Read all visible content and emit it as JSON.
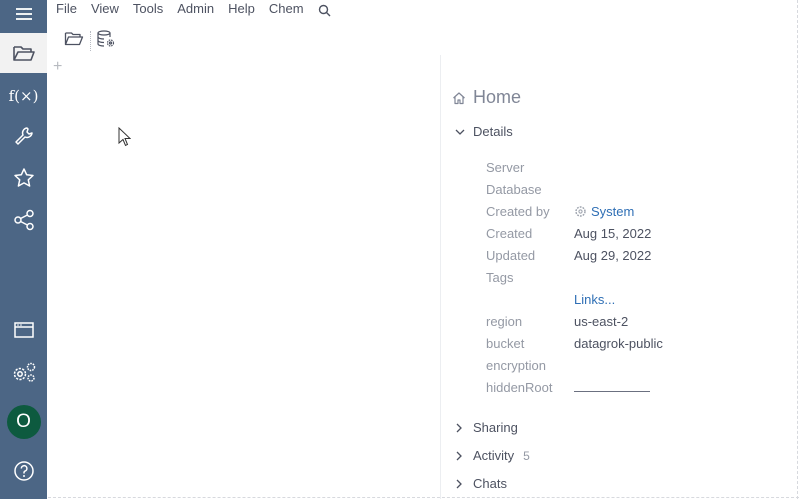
{
  "menu": {
    "items": [
      "File",
      "View",
      "Tools",
      "Admin",
      "Help",
      "Chem"
    ]
  },
  "sidebar": {
    "items": [
      {
        "name": "menu-icon"
      },
      {
        "name": "folder-open-icon"
      },
      {
        "name": "functions-icon",
        "label": "f(x)"
      },
      {
        "name": "wrench-icon"
      },
      {
        "name": "star-icon"
      },
      {
        "name": "share-icon"
      },
      {
        "name": "window-icon"
      },
      {
        "name": "settings-icon"
      },
      {
        "name": "avatar",
        "label": "O"
      },
      {
        "name": "help-icon"
      }
    ],
    "avatar_label": "O",
    "fx_label": "f(",
    "fx_x": "×",
    "fx_close": ")"
  },
  "toolbar": {
    "plus": "+"
  },
  "panel": {
    "title": "Home",
    "details_label": "Details",
    "props": [
      {
        "key": "Server",
        "value": ""
      },
      {
        "key": "Database",
        "value": ""
      },
      {
        "key": "Created by",
        "value": "System"
      },
      {
        "key": "Created",
        "value": "Aug 15, 2022"
      },
      {
        "key": "Updated",
        "value": "Aug 29, 2022"
      },
      {
        "key": "Tags",
        "value": ""
      },
      {
        "key": "",
        "value": "Links..."
      },
      {
        "key": "region",
        "value": "us-east-2"
      },
      {
        "key": "bucket",
        "value": "datagrok-public"
      },
      {
        "key": "encryption",
        "value": ""
      },
      {
        "key": "hiddenRoot",
        "value": ""
      }
    ],
    "sections": [
      {
        "label": "Sharing",
        "count": ""
      },
      {
        "label": "Activity",
        "count": "5"
      },
      {
        "label": "Chats",
        "count": ""
      }
    ]
  },
  "colors": {
    "sidebar": "#4c6685",
    "link": "#2f6fb5",
    "avatar": "#0d5a3f"
  }
}
